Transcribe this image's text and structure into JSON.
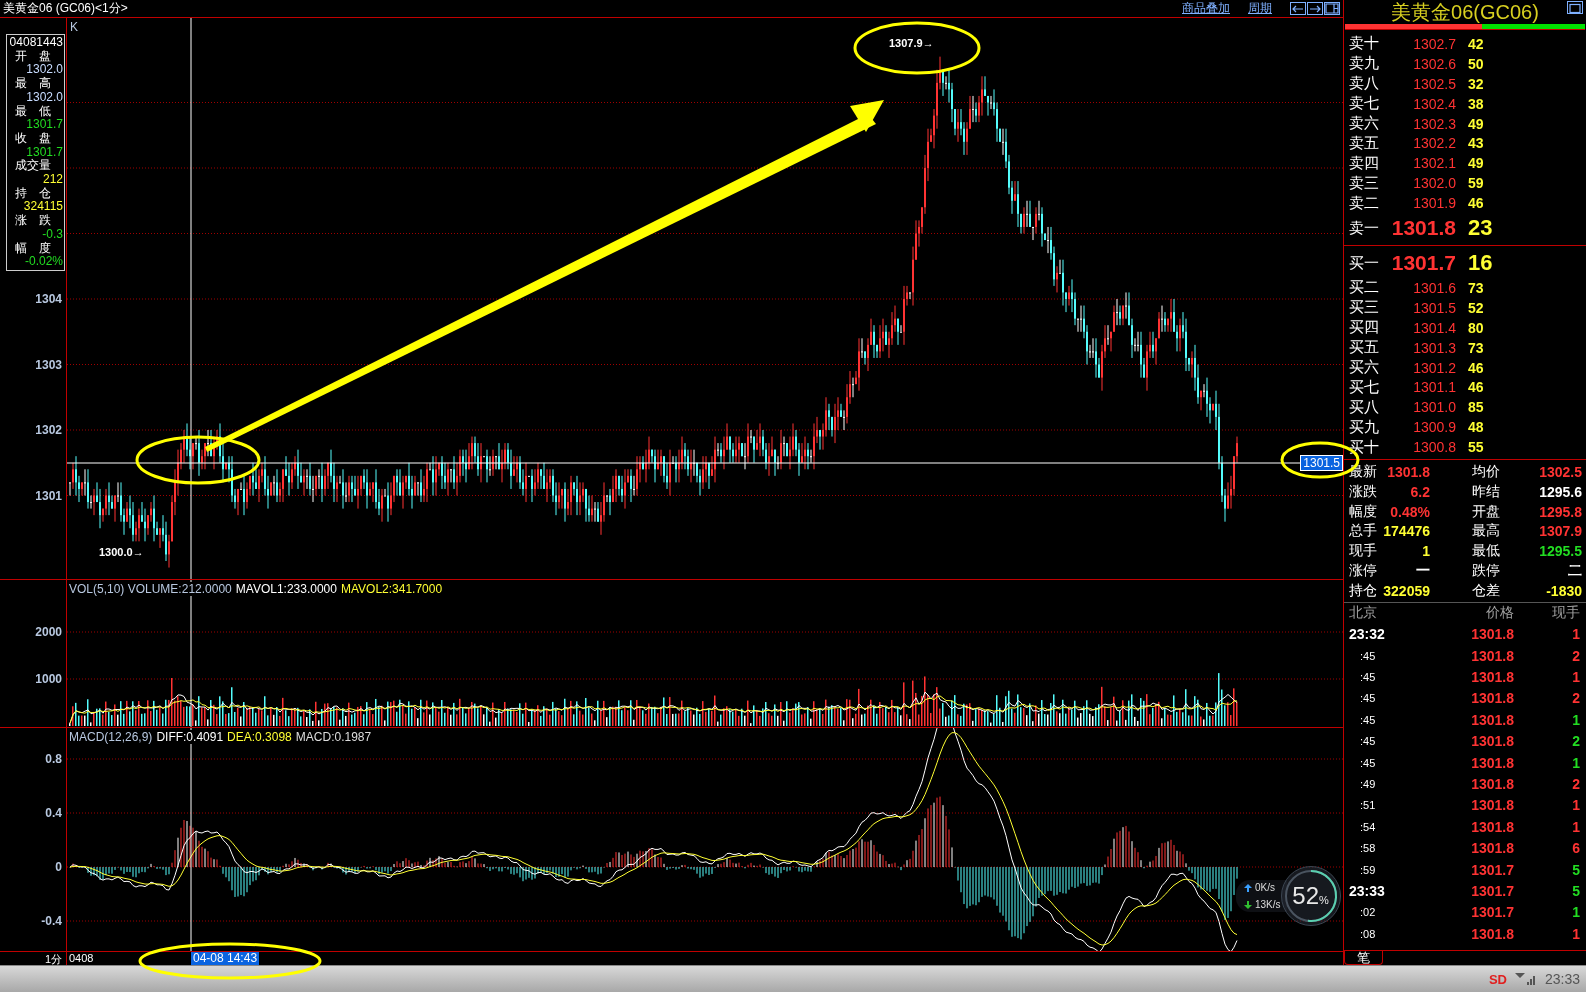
{
  "title_bar": {
    "title": "美黄金06 (GC06)<1分>",
    "links": [
      "商品叠加",
      "周期"
    ]
  },
  "price_pane": {
    "label": "K",
    "yticks": [
      "1304",
      "1303",
      "1302",
      "1301"
    ],
    "cursor_price": "1301.5",
    "high_marker": "1307.9→",
    "low_marker": "1300.0→"
  },
  "info_box": {
    "datetime": "04081443",
    "fields": [
      {
        "label": "开　盘",
        "value": "1302.0",
        "color": "#c8dcff"
      },
      {
        "label": "最　高",
        "value": "1302.0",
        "color": "#c8dcff"
      },
      {
        "label": "最　低",
        "value": "1301.7",
        "color": "#22dd22"
      },
      {
        "label": "收　盘",
        "value": "1301.7",
        "color": "#22dd22"
      },
      {
        "label": "成交量",
        "value": "212",
        "color": "#ffff33"
      },
      {
        "label": "持　仓",
        "value": "324115",
        "color": "#ffff33"
      },
      {
        "label": "涨　跌",
        "value": "-0.3",
        "color": "#22dd22"
      },
      {
        "label": "幅　度",
        "value": "-0.02%",
        "color": "#22dd22"
      }
    ]
  },
  "volume_pane": {
    "legend": [
      {
        "text": "VOL(5,10) VOLUME:212.0000",
        "color": "#b8c8e0"
      },
      {
        "text": "MAVOL1:233.0000",
        "color": "#ffffff"
      },
      {
        "text": "MAVOL2:341.7000",
        "color": "#ffff33"
      }
    ],
    "yticks": [
      "2000",
      "1000"
    ]
  },
  "macd_pane": {
    "legend": [
      {
        "text": "MACD(12,26,9)",
        "color": "#b8c8e0"
      },
      {
        "text": "DIFF:0.4091",
        "color": "#ffffff"
      },
      {
        "text": "DEA:0.3098",
        "color": "#ffff33"
      },
      {
        "text": "MACD:0.1987",
        "color": "#dddddd"
      }
    ],
    "yticks": [
      "0.8",
      "0.4",
      "0",
      "-0.4"
    ]
  },
  "time_axis": {
    "period": "1分",
    "date": "0408",
    "cursor_time": "04-08 14:43"
  },
  "quote_panel": {
    "title": "美黄金06(GC06)",
    "ratio_bar": {
      "level": 0.57
    },
    "asks": [
      {
        "label": "卖十",
        "price": "1302.7",
        "volume": "42",
        "kind": "level"
      },
      {
        "label": "卖九",
        "price": "1302.6",
        "volume": "50",
        "kind": "level"
      },
      {
        "label": "卖八",
        "price": "1302.5",
        "volume": "32",
        "kind": "level"
      },
      {
        "label": "卖七",
        "price": "1302.4",
        "volume": "38",
        "kind": "level"
      },
      {
        "label": "卖六",
        "price": "1302.3",
        "volume": "49",
        "kind": "level"
      },
      {
        "label": "卖五",
        "price": "1302.2",
        "volume": "43",
        "kind": "level"
      },
      {
        "label": "卖四",
        "price": "1302.1",
        "volume": "49",
        "kind": "level"
      },
      {
        "label": "卖三",
        "price": "1302.0",
        "volume": "59",
        "kind": "level"
      },
      {
        "label": "卖二",
        "price": "1301.9",
        "volume": "46",
        "kind": "level"
      },
      {
        "label": "卖一",
        "price": "1301.8",
        "volume": "23",
        "kind": "best"
      }
    ],
    "bids": [
      {
        "label": "买一",
        "price": "1301.7",
        "volume": "16",
        "kind": "best"
      },
      {
        "label": "买二",
        "price": "1301.6",
        "volume": "73",
        "kind": "level"
      },
      {
        "label": "买三",
        "price": "1301.5",
        "volume": "52",
        "kind": "level"
      },
      {
        "label": "买四",
        "price": "1301.4",
        "volume": "80",
        "kind": "level"
      },
      {
        "label": "买五",
        "price": "1301.3",
        "volume": "73",
        "kind": "level"
      },
      {
        "label": "买六",
        "price": "1301.2",
        "volume": "46",
        "kind": "level"
      },
      {
        "label": "买七",
        "price": "1301.1",
        "volume": "46",
        "kind": "level"
      },
      {
        "label": "买八",
        "price": "1301.0",
        "volume": "85",
        "kind": "level"
      },
      {
        "label": "买九",
        "price": "1300.9",
        "volume": "48",
        "kind": "level"
      },
      {
        "label": "买十",
        "price": "1300.8",
        "volume": "55",
        "kind": "level"
      }
    ],
    "stats": [
      {
        "label": "最新",
        "value": "1301.8",
        "color": "#ff3333"
      },
      {
        "label": "均价",
        "value": "1302.5",
        "color": "#ff3333"
      },
      {
        "label": "涨跌",
        "value": "6.2",
        "color": "#ff3333"
      },
      {
        "label": "昨结",
        "value": "1295.6",
        "color": "#ffffff"
      },
      {
        "label": "幅度",
        "value": "0.48%",
        "color": "#ff3333"
      },
      {
        "label": "开盘",
        "value": "1295.8",
        "color": "#ff3333"
      },
      {
        "label": "总手",
        "value": "174476",
        "color": "#ffff33"
      },
      {
        "label": "最高",
        "value": "1307.9",
        "color": "#ff3333"
      },
      {
        "label": "现手",
        "value": "1",
        "color": "#ffff33"
      },
      {
        "label": "最低",
        "value": "1295.5",
        "color": "#22dd22"
      },
      {
        "label": "涨停",
        "value": "一",
        "color": "#ffffff"
      },
      {
        "label": "跌停",
        "value": "二",
        "color": "#ffffff"
      },
      {
        "label": "持仓",
        "value": "322059",
        "color": "#ffff33"
      },
      {
        "label": "仓差",
        "value": "-1830",
        "color": "#ffff33"
      }
    ],
    "ticks": {
      "columns": [
        "北京",
        "价格",
        "现手"
      ],
      "rows": [
        {
          "time": "23:32",
          "kind": "minute",
          "price": "1301.8",
          "volume": "1",
          "color": "#ff3333"
        },
        {
          "time": ":45",
          "kind": "second",
          "price": "1301.8",
          "volume": "2",
          "color": "#ff3333"
        },
        {
          "time": ":45",
          "kind": "second",
          "price": "1301.8",
          "volume": "1",
          "color": "#ff3333"
        },
        {
          "time": ":45",
          "kind": "second",
          "price": "1301.8",
          "volume": "2",
          "color": "#ff3333"
        },
        {
          "time": ":45",
          "kind": "second",
          "price": "1301.8",
          "volume": "1",
          "color": "#22dd22"
        },
        {
          "time": ":45",
          "kind": "second",
          "price": "1301.8",
          "volume": "2",
          "color": "#22dd22"
        },
        {
          "time": ":45",
          "kind": "second",
          "price": "1301.8",
          "volume": "1",
          "color": "#22dd22"
        },
        {
          "time": ":49",
          "kind": "second",
          "price": "1301.8",
          "volume": "2",
          "color": "#ff3333"
        },
        {
          "time": ":51",
          "kind": "second",
          "price": "1301.8",
          "volume": "1",
          "color": "#ff3333"
        },
        {
          "time": ":54",
          "kind": "second",
          "price": "1301.8",
          "volume": "1",
          "color": "#ff3333"
        },
        {
          "time": ":58",
          "kind": "second",
          "price": "1301.8",
          "volume": "6",
          "color": "#ff3333"
        },
        {
          "time": ":59",
          "kind": "second",
          "price": "1301.7",
          "volume": "5",
          "color": "#22dd22"
        },
        {
          "time": "23:33",
          "kind": "minute",
          "price": "1301.7",
          "volume": "5",
          "color": "#22dd22"
        },
        {
          "time": ":02",
          "kind": "second",
          "price": "1301.7",
          "volume": "1",
          "color": "#22dd22"
        },
        {
          "time": ":08",
          "kind": "second",
          "price": "1301.8",
          "volume": "1",
          "color": "#ff3333"
        }
      ]
    },
    "tab": "笔"
  },
  "net_widget": {
    "upload": "0K/s",
    "download": "13K/s",
    "percent": "52",
    "unit": "%"
  },
  "status_bar": {
    "indicator": "SD",
    "clock": "23:33"
  }
}
